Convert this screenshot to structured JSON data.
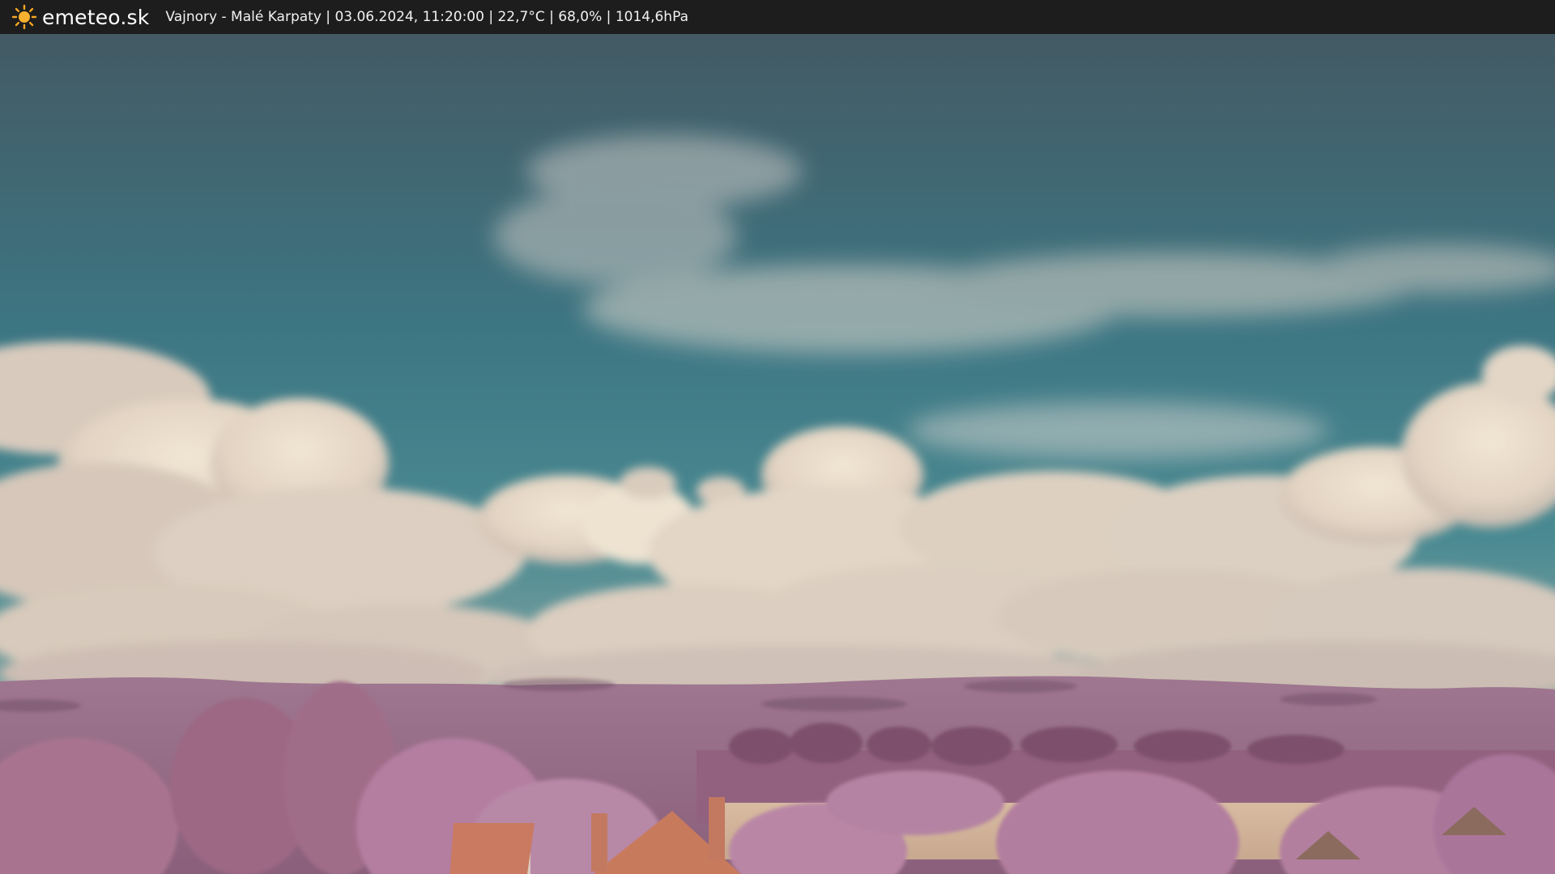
{
  "header": {
    "brand": "emeteo.sk",
    "location": "Vajnory - Malé Karpaty",
    "datetime": "03.06.2024, 11:20:00",
    "temperature": "22,7°C",
    "humidity": "68,0%",
    "pressure": "1014,6hPa",
    "separator": " | ",
    "logo_icon": "sun-icon"
  },
  "scene": {
    "description_icon": "webcam-image",
    "colors": {
      "sky_top": "#3f5a66",
      "sky_mid": "#3c7f8c",
      "cloud": "#e9dccb",
      "hills": "#9a6f89",
      "trees": "#b07c9e",
      "roof": "#c8775d",
      "field": "#d3b49a",
      "bar": "#1d1d1d"
    }
  }
}
